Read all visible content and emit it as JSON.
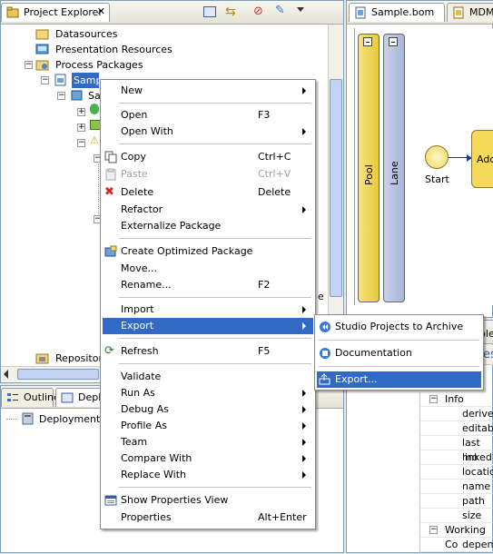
{
  "explorer": {
    "tab_label": "Project Explorer",
    "tree": [
      {
        "label": "Datasources"
      },
      {
        "label": "Presentation Resources"
      },
      {
        "label": "Process Packages"
      },
      {
        "label": "Sample.xpdl"
      },
      {
        "label": "Sa"
      },
      {
        "label": "Repository"
      }
    ]
  },
  "editor": {
    "tabs": [
      "Sample.bom",
      "MDM M"
    ],
    "pool_label": "Pool",
    "lane_label": "Lane",
    "start_label": "Start",
    "task_label": "Add"
  },
  "bottom_left": {
    "tabs": [
      "Outline",
      "Deplo"
    ],
    "item": "Deployment S"
  },
  "properties": {
    "partial_tab": "ple",
    "partial_title": "es",
    "rows": [
      {
        "label": "Info",
        "group": true
      },
      {
        "label": "derived"
      },
      {
        "label": "editable"
      },
      {
        "label": "last mo"
      },
      {
        "label": "linked"
      },
      {
        "label": "location"
      },
      {
        "label": "name"
      },
      {
        "label": "path"
      },
      {
        "label": "size"
      },
      {
        "label": "Working Co",
        "group": true
      },
      {
        "label": "depend"
      }
    ]
  },
  "partial_e": "e",
  "context_menu": {
    "items": [
      {
        "label": "New",
        "submenu": true
      },
      {
        "label": "Open",
        "shortcut": "F3"
      },
      {
        "label": "Open With",
        "submenu": true
      },
      {
        "label": "Copy",
        "shortcut": "Ctrl+C"
      },
      {
        "label": "Paste",
        "shortcut": "Ctrl+V",
        "disabled": true
      },
      {
        "label": "Delete",
        "shortcut": "Delete"
      },
      {
        "label": "Refactor",
        "submenu": true
      },
      {
        "label": "Externalize Package"
      },
      {
        "label": "Create Optimized Package"
      },
      {
        "label": "Move..."
      },
      {
        "label": "Rename...",
        "shortcut": "F2"
      },
      {
        "label": "Import",
        "submenu": true
      },
      {
        "label": "Export",
        "submenu": true,
        "highlighted": true
      },
      {
        "label": "Refresh",
        "shortcut": "F5"
      },
      {
        "label": "Validate"
      },
      {
        "label": "Run As",
        "submenu": true
      },
      {
        "label": "Debug As",
        "submenu": true
      },
      {
        "label": "Profile As",
        "submenu": true
      },
      {
        "label": "Team",
        "submenu": true
      },
      {
        "label": "Compare With",
        "submenu": true
      },
      {
        "label": "Replace With",
        "submenu": true
      },
      {
        "label": "Show Properties View"
      },
      {
        "label": "Properties",
        "shortcut": "Alt+Enter"
      }
    ]
  },
  "export_submenu": {
    "items": [
      {
        "label": "Studio Projects to Archive"
      },
      {
        "label": "Documentation"
      },
      {
        "label": "Export...",
        "highlighted": true
      }
    ]
  },
  "colors": {
    "highlight": "#316ac5",
    "pool": "#f0d858",
    "lane": "#b8c3e2",
    "window": "#ece9d8"
  }
}
